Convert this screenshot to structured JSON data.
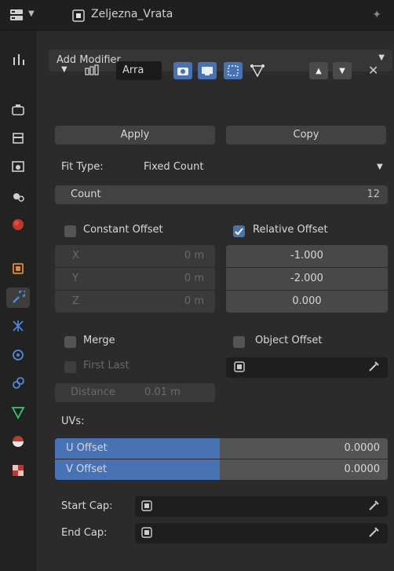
{
  "header": {
    "object_name": "Zeljezna_Vrata"
  },
  "add_modifier": {
    "label": "Add Modifier"
  },
  "modifier": {
    "name": "Arra",
    "apply": "Apply",
    "copy": "Copy",
    "fit_type": {
      "label": "Fit Type:",
      "value": "Fixed Count"
    },
    "count": {
      "label": "Count",
      "value": "12"
    },
    "constant_offset": {
      "label": "Constant Offset",
      "checked": false,
      "rows": [
        {
          "axis": "X",
          "value": "0 m"
        },
        {
          "axis": "Y",
          "value": "0 m"
        },
        {
          "axis": "Z",
          "value": "0 m"
        }
      ]
    },
    "relative_offset": {
      "label": "Relative Offset",
      "checked": true,
      "values": [
        "-1.000",
        "-2.000",
        "0.000"
      ]
    },
    "merge": {
      "label": "Merge",
      "checked": false
    },
    "first_last": {
      "label": "First Last",
      "checked": false
    },
    "distance": {
      "label": "Distance",
      "value": "0.01 m"
    },
    "object_offset": {
      "label": "Object Offset",
      "checked": false
    },
    "uvs": {
      "label": "UVs:",
      "u_offset": {
        "label": "U Offset",
        "value": "0.0000"
      },
      "v_offset": {
        "label": "V Offset",
        "value": "0.0000"
      }
    },
    "start_cap": {
      "label": "Start Cap:"
    },
    "end_cap": {
      "label": "End Cap:"
    }
  },
  "colors": {
    "accent": "#4772b3",
    "panel": "#2b2b2b",
    "field": "#424242"
  }
}
